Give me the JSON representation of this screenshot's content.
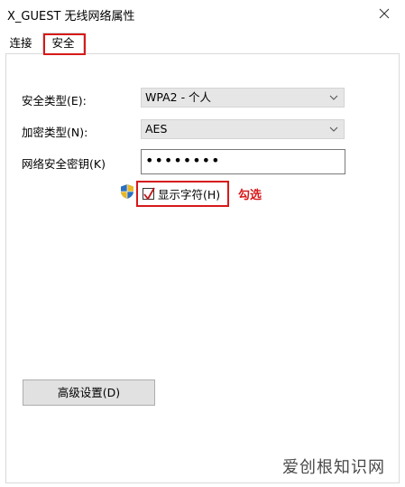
{
  "window": {
    "title": "X_GUEST 无线网络属性"
  },
  "tabs": [
    {
      "label": "连接",
      "selected": false
    },
    {
      "label": "安全",
      "selected": true
    }
  ],
  "security": {
    "security_type_label": "安全类型(E):",
    "security_type_value": "WPA2 - 个人",
    "encryption_type_label": "加密类型(N):",
    "encryption_type_value": "AES",
    "network_key_label": "网络安全密钥(K)",
    "network_key_value": "••••••••",
    "show_characters_label": "显示字符(H)",
    "show_characters_checked": true
  },
  "annotation": {
    "text": "勾选",
    "color": "#d7191a"
  },
  "advanced_button_label": "高级设置(D)",
  "watermark": "爱创根知识网",
  "colors": {
    "highlight": "#d7191a",
    "button_bg": "#e1e1e1",
    "select_bg": "#e6e6e6"
  },
  "icons": [
    "close-icon",
    "chevron-down-icon",
    "uac-shield-icon",
    "checkmark-icon"
  ]
}
